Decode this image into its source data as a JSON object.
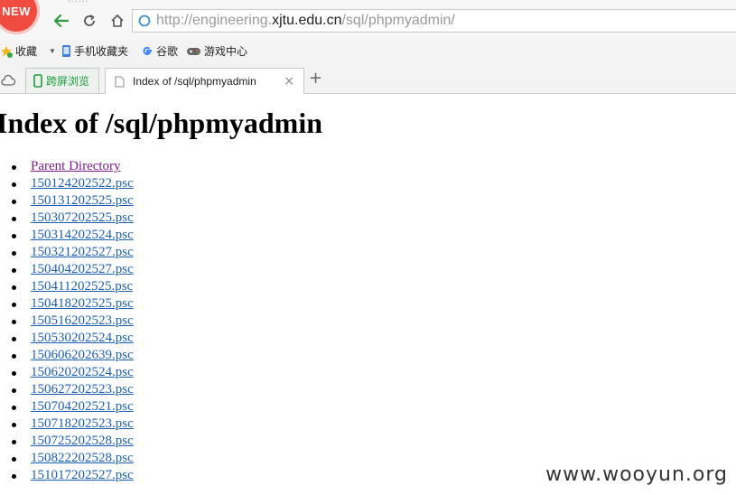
{
  "browser": {
    "badge": "NEW",
    "faint_title": "……",
    "url": {
      "prefix": "http://engineering.",
      "domain": "xjtu.edu.cn",
      "path": "/sql/phpmyadmin/"
    },
    "bookmarks": [
      {
        "label": "收藏",
        "icon": "star-add-icon"
      },
      {
        "label": "手机收藏夹",
        "icon": "phone-icon"
      },
      {
        "label": "谷歌",
        "icon": "google-icon"
      },
      {
        "label": "游戏中心",
        "icon": "gamepad-icon"
      }
    ],
    "tabs": [
      {
        "label": "跨屏浏览"
      },
      {
        "label": "Index of /sql/phpmyadmin"
      }
    ],
    "new_tab_symbol": "+",
    "close_symbol": "×"
  },
  "page": {
    "title": "Index of /sql/phpmyadmin",
    "parent": "Parent Directory",
    "files": [
      "150124202522.psc",
      "150131202525.psc",
      "150307202525.psc",
      "150314202524.psc",
      "150321202527.psc",
      "150404202527.psc",
      "150411202525.psc",
      "150418202525.psc",
      "150516202523.psc",
      "150530202524.psc",
      "150606202639.psc",
      "150620202524.psc",
      "150627202523.psc",
      "150704202521.psc",
      "150718202523.psc",
      "150725202528.psc",
      "150822202528.psc",
      "151017202527.psc"
    ]
  },
  "watermark": "www.wooyun.org",
  "colors": {
    "link": "#1c5fb4",
    "visited": "#7b1e8a",
    "badge": "#ef4b3f",
    "tab_green": "#1a9c3a"
  }
}
